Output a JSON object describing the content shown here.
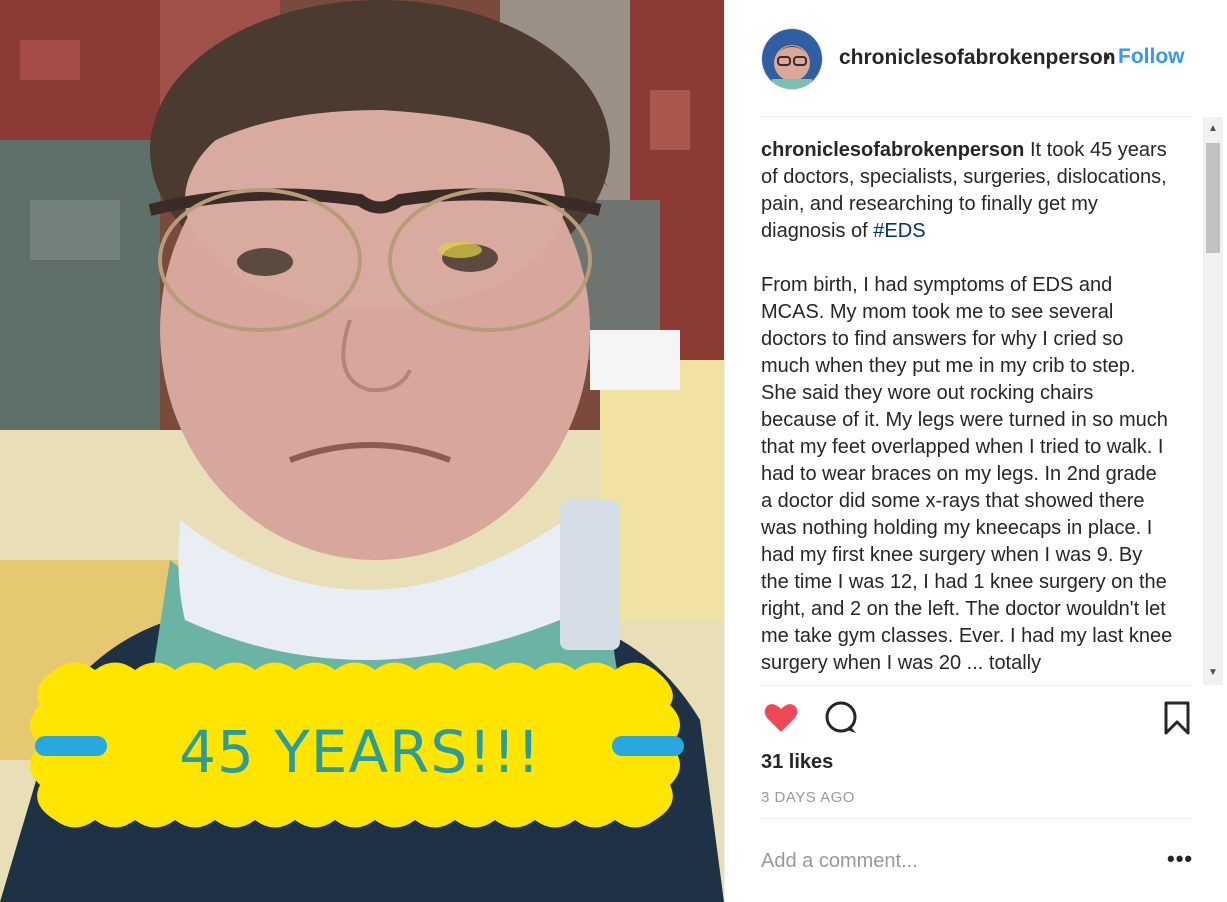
{
  "post": {
    "username": "chroniclesofabrokenperson",
    "separator": "•",
    "follow_label": "Follow",
    "image_overlay_text": "45 YEARS!!!",
    "caption_text": " It took 45 years of doctors, specialists, surgeries, dislocations, pain, and researching to finally get my diagnosis of ",
    "caption_hashtag": "#EDS",
    "caption_body": "\n\nFrom birth, I had symptoms of EDS and MCAS. My mom took me to see several doctors to find answers for why I cried so much when they put me in my crib to step. She said they wore out rocking chairs because of it. My legs were turned in so much that my feet overlapped when I tried to walk. I had to wear braces on my legs. In 2nd grade a doctor did some x-rays that showed there was nothing holding my kneecaps in place. I had my first knee surgery when I was 9. By the time I was 12, I had 1 knee surgery on the right, and 2 on the left. The doctor wouldn't let me take gym classes. Ever. I had my last knee surgery when I was 20 ... totally",
    "likes": "31 likes",
    "timestamp": "3 DAYS AGO",
    "comment_placeholder": "Add a comment...",
    "more_label": "•••"
  },
  "icons": {
    "like": "heart-filled-icon",
    "comment": "comment-bubble-icon",
    "save": "bookmark-icon",
    "scroll_up": "▲",
    "scroll_down": "▼"
  },
  "colors": {
    "link_blue": "#3897f0",
    "like_red": "#ed4956",
    "hashtag": "#003569",
    "sticker_yellow": "#ffe500",
    "sticker_text": "#2a9d9a",
    "sticker_bar": "#29a8e0",
    "muted": "#999999"
  }
}
